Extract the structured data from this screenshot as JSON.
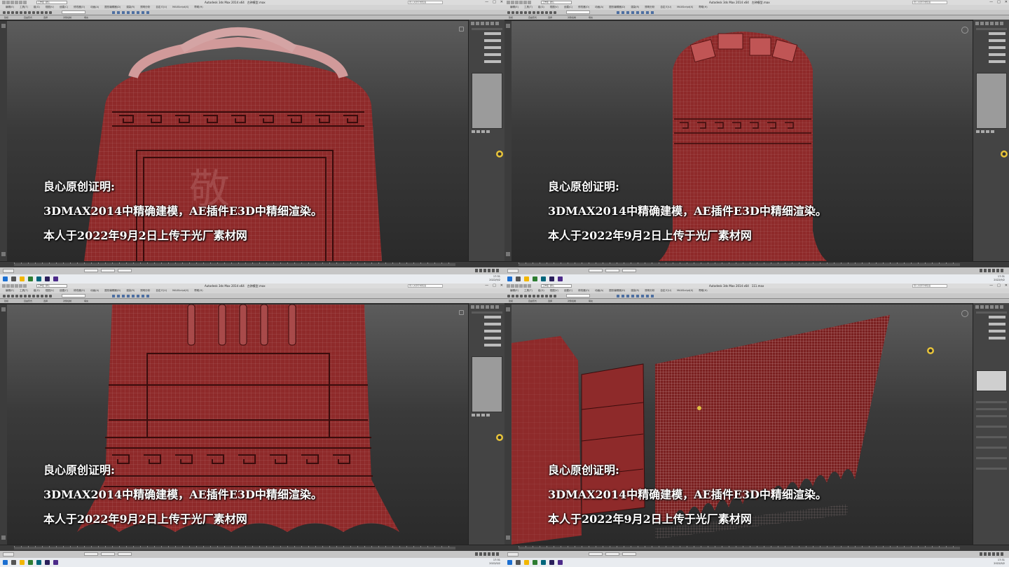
{
  "window": {
    "title_main": "Autodesk 3ds Max  2014 x64",
    "file_tl": "古钟模型.max",
    "file_tr": "古钟模型.max",
    "file_bl": "古钟模型.max",
    "file_br": "111.max",
    "workspace": "工作区: 默认",
    "search_placeholder": "键入关键字或短语",
    "min": "—",
    "max": "□",
    "close": "✕"
  },
  "menu": [
    "编辑(E)",
    "工具(T)",
    "组(G)",
    "视图(V)",
    "创建(C)",
    "修改器(O)",
    "动画(A)",
    "图形编辑器(D)",
    "渲染(R)",
    "照明分析",
    "自定义(U)",
    "MAXScript(X)",
    "帮助(H)"
  ],
  "ribbon_sub": [
    "建模",
    "自由形式",
    "选择",
    "对象绘制",
    "填充"
  ],
  "overlay": {
    "line1": "良心原创证明:",
    "line2": "3DMAX2014中精确建模，AE插件E3D中精细渲染。",
    "line3": "本人于2022年9月2日上传于光厂素材网"
  },
  "taskbar": {
    "time": "17:31",
    "date": "2022/9/2"
  },
  "colors": {
    "model_red": "#8e2a2a",
    "wire": "#c9a0a0",
    "viewport_top": "#5c5c5c",
    "viewport_bottom": "#2a2a2a"
  },
  "icons": [
    "bell-handle-icon",
    "viewcube-icon",
    "render-logo-icon",
    "search-icon",
    "windows-start-icon"
  ]
}
